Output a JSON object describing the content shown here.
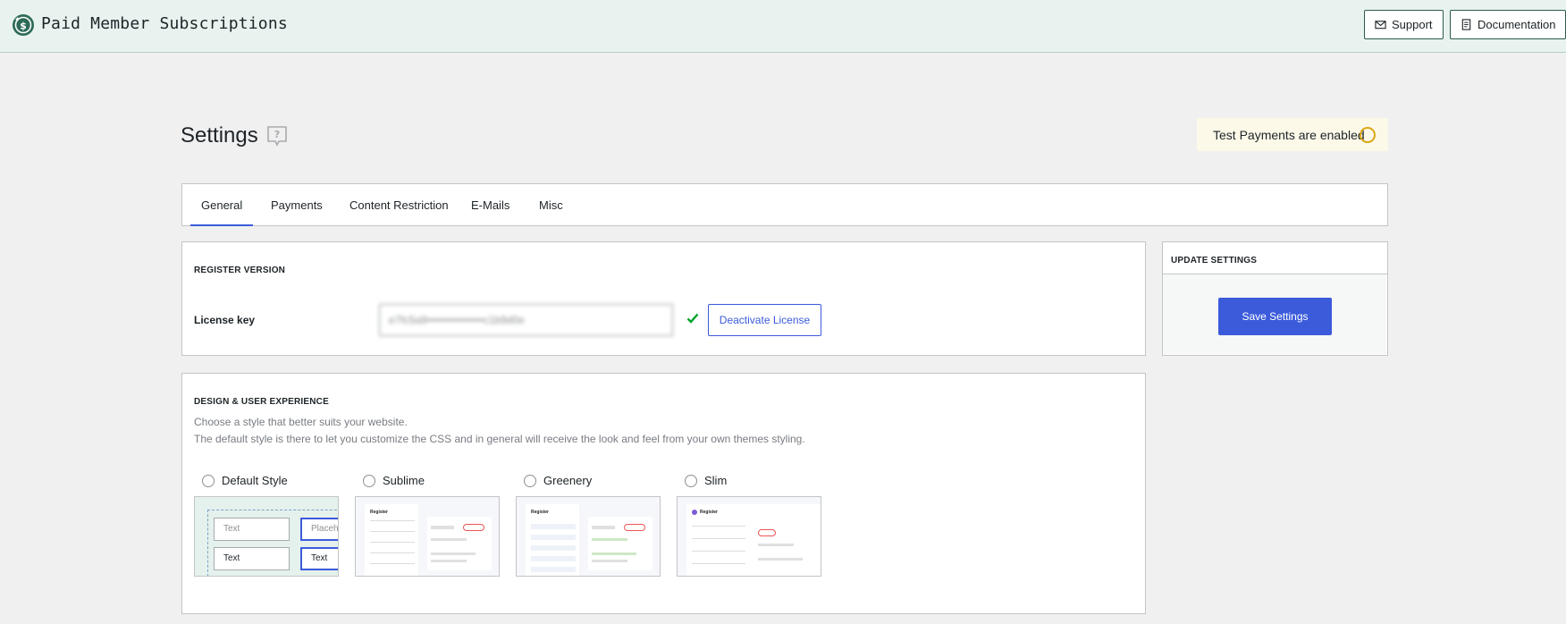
{
  "header": {
    "brand": "Paid Member Subscriptions",
    "support_label": "Support",
    "docs_label": "Documentation"
  },
  "page": {
    "title": "Settings",
    "test_payments": "Test Payments are enabled"
  },
  "tabs": [
    {
      "label": "General",
      "active": true
    },
    {
      "label": "Payments"
    },
    {
      "label": "Content Restriction"
    },
    {
      "label": "E-Mails"
    },
    {
      "label": "Misc"
    }
  ],
  "register": {
    "heading": "REGISTER VERSION",
    "license_label": "License key",
    "license_value": "e7fc5a9•••••••••••••••c1b9d0e",
    "deactivate_label": "Deactivate License"
  },
  "update": {
    "heading": "UPDATE SETTINGS",
    "save_label": "Save Settings"
  },
  "design": {
    "heading": "DESIGN & USER EXPERIENCE",
    "desc1": "Choose a style that better suits your website.",
    "desc2": "The default style is there to let you customize the CSS and in general will receive the look and feel from your own themes styling.",
    "styles": [
      {
        "label": "Default Style"
      },
      {
        "label": "Sublime"
      },
      {
        "label": "Greenery"
      },
      {
        "label": "Slim"
      }
    ],
    "default_preview": {
      "field1": "Text",
      "field2": "Placeholder",
      "field3": "Text",
      "field4": "Text"
    },
    "preview_heading": "Register"
  },
  "colors": {
    "accent": "#3b5bdb",
    "brand_green": "#2d5b4e",
    "warning": "#dba617"
  }
}
